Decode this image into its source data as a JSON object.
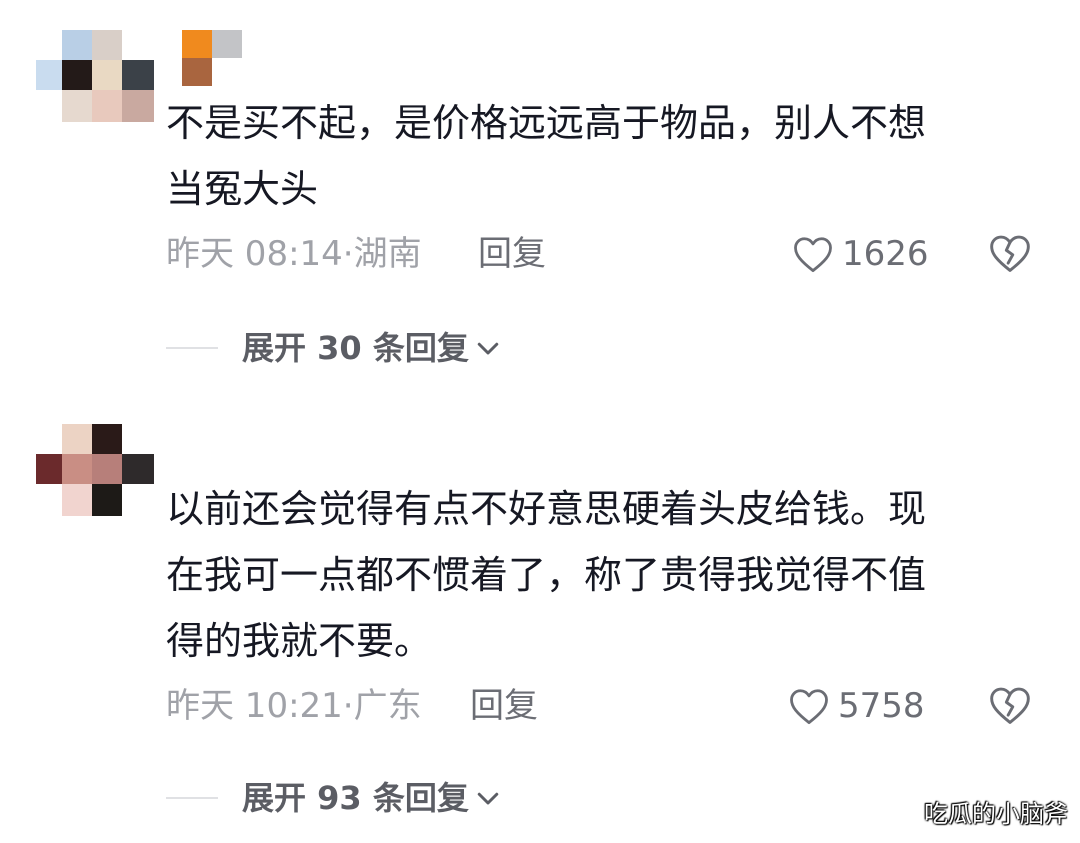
{
  "comments": [
    {
      "text_lines": [
        "不是买不起，是价格远远高于物品，别人不想",
        "当冤大头"
      ],
      "time": "昨天 08:14",
      "separator": "·",
      "location": "湖南",
      "reply_label": "回复",
      "likes": "1626",
      "expand_label": "展开 30 条回复"
    },
    {
      "text_lines": [
        "以前还会觉得有点不好意思硬着头皮给钱。现",
        "在我可一点都不惯着了，称了贵得我觉得不值",
        "得的我就不要。"
      ],
      "time": "昨天 10:21",
      "separator": "·",
      "location": "广东",
      "reply_label": "回复",
      "likes": "5758",
      "expand_label": "展开 93 条回复"
    }
  ],
  "watermark": "吃瓜的小脑斧",
  "icons": {
    "like": "heart-outline-icon",
    "dislike": "broken-heart-icon",
    "expand": "chevron-down-icon"
  },
  "colors": {
    "text": "#161823",
    "meta": "#a0a2a8",
    "action": "#6b6d74",
    "expand": "#5b5d64"
  }
}
